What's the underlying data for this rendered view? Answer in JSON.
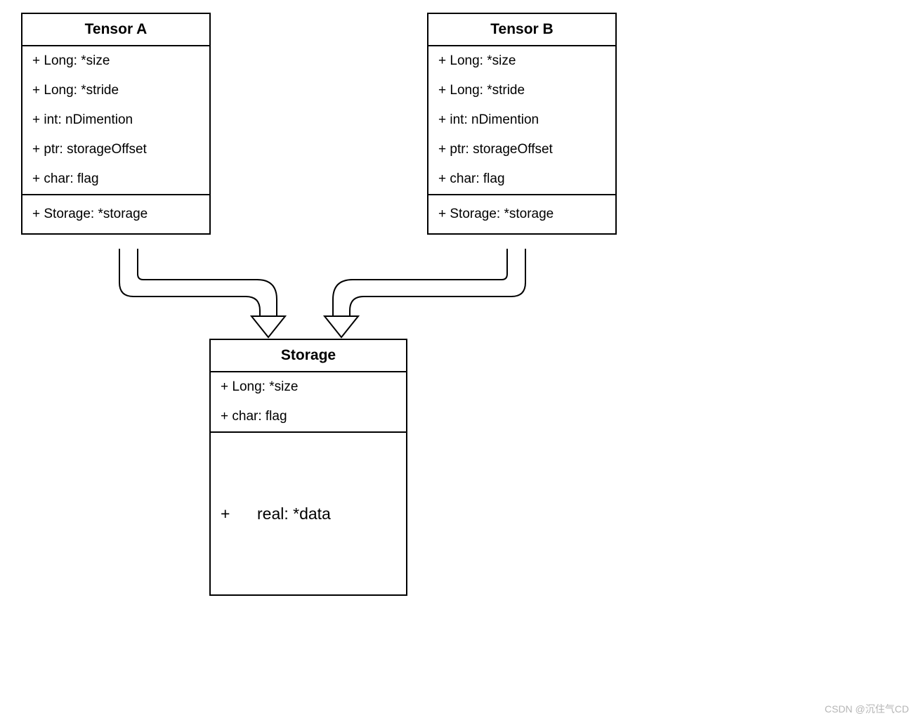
{
  "tensor_a": {
    "title": "Tensor A",
    "attrs": [
      "+ Long: *size",
      "+ Long: *stride",
      "+ int:  nDimention",
      "+ ptr: storageOffset",
      "+ char: flag"
    ],
    "storage_ref": "+ Storage: *storage"
  },
  "tensor_b": {
    "title": "Tensor B",
    "attrs": [
      "+ Long: *size",
      "+ Long: *stride",
      "+ int:  nDimention",
      "+ ptr: storageOffset",
      "+ char: flag"
    ],
    "storage_ref": "+ Storage: *storage"
  },
  "storage": {
    "title": "Storage",
    "attrs": [
      "+ Long: *size",
      "+ char: flag"
    ],
    "data_plus": "+",
    "data_label": "real: *data"
  },
  "watermark": "CSDN @沉住气CD"
}
